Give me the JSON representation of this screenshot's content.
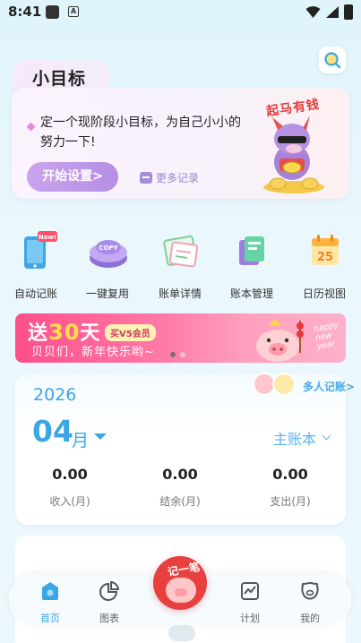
{
  "status_bar": {
    "time": "8:41",
    "a_icon": "A"
  },
  "goal": {
    "tab_title": "小目标",
    "description": "定一个现阶段小目标，为自己小小的努力一下!",
    "start_button": "开始设置>",
    "more_records": "更多记录",
    "mascot_caption": "起马有钱"
  },
  "actions": [
    {
      "label": "自动记账",
      "icon": "phone-new-icon",
      "badge": "New!"
    },
    {
      "label": "一键复用",
      "icon": "copy-button-icon",
      "badge_text": "COPY"
    },
    {
      "label": "账单详情",
      "icon": "bill-detail-icon"
    },
    {
      "label": "账本管理",
      "icon": "ledger-books-icon"
    },
    {
      "label": "日历视图",
      "icon": "calendar-icon",
      "day": "25"
    }
  ],
  "banner": {
    "line1_prefix": "送",
    "line1_number": "30",
    "line1_suffix": "天",
    "vip_tag": "买V5会员",
    "line2": "贝贝们，新年快乐哟~",
    "year_text": "happy new year"
  },
  "month_card": {
    "year": "2026",
    "month": "04",
    "month_unit": "月",
    "ledger": "主账本",
    "multi_user": "多人记账>",
    "stats": [
      {
        "value": "0.00",
        "label": "收入(月)"
      },
      {
        "value": "0.00",
        "label": "结余(月)"
      },
      {
        "value": "0.00",
        "label": "支出(月)"
      }
    ]
  },
  "fab": {
    "text": "记一笔"
  },
  "nav": [
    {
      "label": "首页",
      "active": true
    },
    {
      "label": "图表",
      "active": false
    },
    {
      "label": "计划",
      "active": false
    },
    {
      "label": "我的",
      "active": false
    }
  ],
  "colors": {
    "accent_blue": "#3aa6e6",
    "purple": "#b68ee4",
    "banner_pink": "#ff4f8a",
    "fab_red": "#e8403f"
  }
}
